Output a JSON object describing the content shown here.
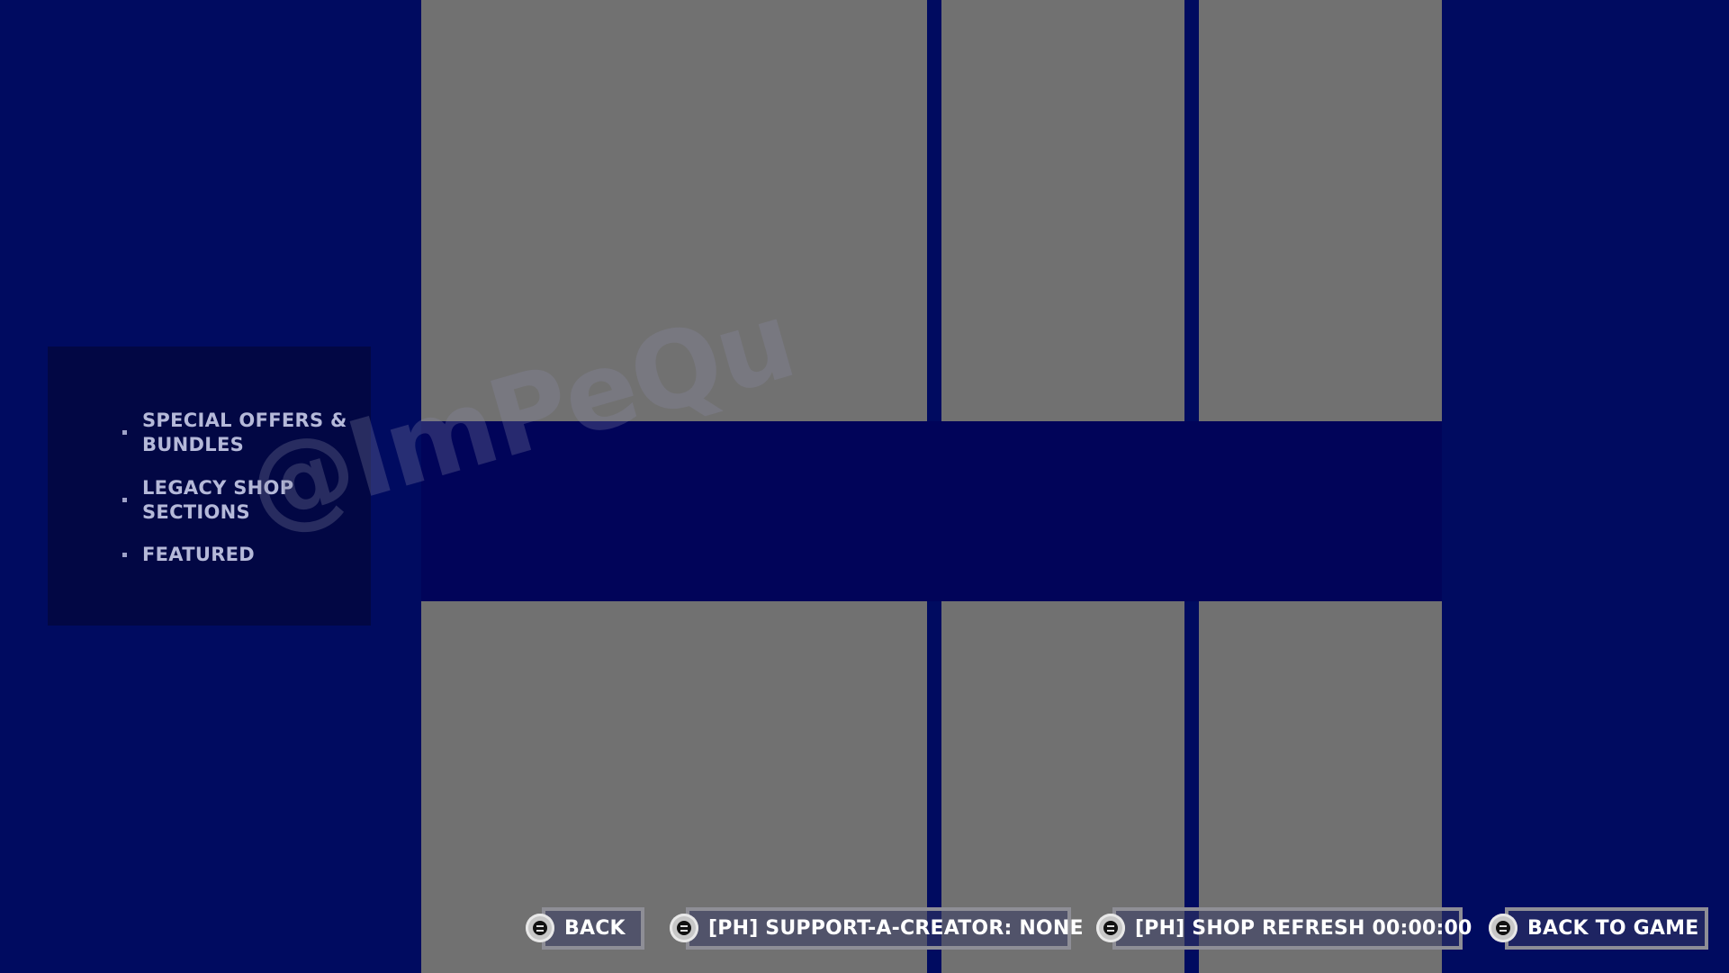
{
  "nav": {
    "items": [
      {
        "label": "SPECIAL OFFERS & BUNDLES"
      },
      {
        "label": "LEGACY SHOP SECTIONS"
      },
      {
        "label": "FEATURED"
      }
    ]
  },
  "watermark": "@ImPeQu",
  "actions": {
    "back": "BACK",
    "support_a_creator": "[PH] SUPPORT-A-CREATOR: NONE",
    "shop_refresh": "[PH] SHOP REFRESH 00:00:00",
    "back_to_game": "BACK TO GAME"
  },
  "colors": {
    "background": "#000b60",
    "tile": "#717171",
    "panel": "#020744",
    "nav_text": "#b5b9d9"
  }
}
